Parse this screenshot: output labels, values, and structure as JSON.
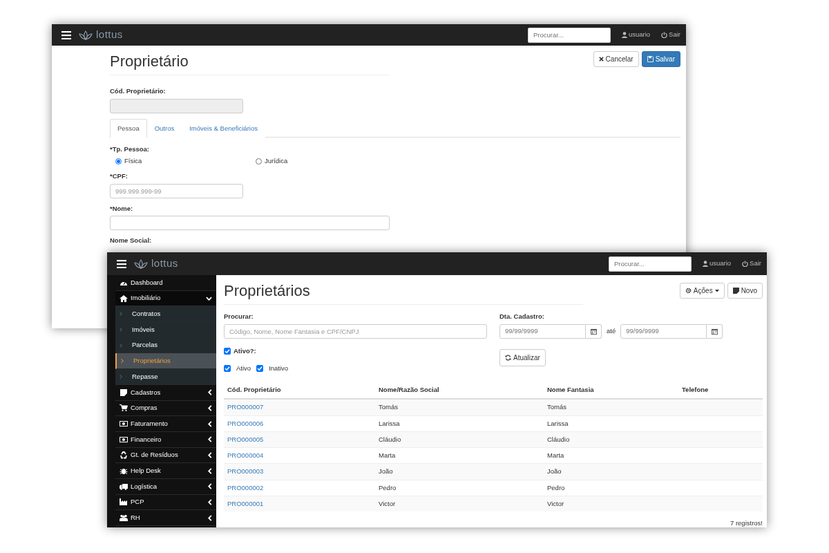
{
  "form_window": {
    "navbar": {
      "brand": "lottus",
      "search_placeholder": "Procurar...",
      "user": "usuario",
      "logout": "Sair"
    },
    "title": "Proprietário",
    "buttons": [
      {
        "kind": "cancel",
        "label": "Cancelar"
      },
      {
        "kind": "save",
        "label": "Salvar"
      }
    ],
    "code_field": {
      "label": "Cód. Proprietário:",
      "disabled": true
    },
    "tabs": [
      {
        "label": "Pessoa",
        "selected": true
      },
      {
        "label": "Outros",
        "selected": false
      },
      {
        "label": "Imóveis & Beneficiários",
        "selected": false
      }
    ],
    "person_type": {
      "label": "*Tp. Pessoa:",
      "options": [
        {
          "label": "Física",
          "selected": true
        },
        {
          "label": "Jurídica",
          "selected": false
        }
      ]
    },
    "cpf_field": {
      "label": "*CPF:",
      "placeholder": "999.999.999-99"
    },
    "name_field": {
      "label": "*Nome:"
    },
    "social_name_label": "Nome Social:"
  },
  "list_window": {
    "navbar": {
      "brand": "lottus",
      "search_placeholder": "Procurar...",
      "user": "usuario",
      "logout": "Sair"
    },
    "sidebar": {
      "items": [
        {
          "kind": "link",
          "label": "Dashboard"
        },
        {
          "kind": "group",
          "label": "Imobiliário",
          "expanded": true,
          "children": [
            {
              "label": "Contratos",
              "selected": false
            },
            {
              "label": "Imóveis",
              "selected": false
            },
            {
              "label": "Parcelas",
              "selected": false
            },
            {
              "label": "Proprietários",
              "selected": true
            },
            {
              "label": "Repasse",
              "selected": false
            }
          ]
        },
        {
          "kind": "group",
          "label": "Cadastros",
          "expanded": false
        },
        {
          "kind": "group",
          "label": "Compras",
          "expanded": false
        },
        {
          "kind": "group",
          "label": "Faturamento",
          "expanded": false
        },
        {
          "kind": "group",
          "label": "Financeiro",
          "expanded": false
        },
        {
          "kind": "group",
          "label": "Gt. de Resíduos",
          "expanded": false
        },
        {
          "kind": "group",
          "label": "Help Desk",
          "expanded": false
        },
        {
          "kind": "group",
          "label": "Logística",
          "expanded": false
        },
        {
          "kind": "group",
          "label": "PCP",
          "expanded": false
        },
        {
          "kind": "group",
          "label": "RH",
          "expanded": false
        }
      ]
    },
    "title": "Proprietários",
    "buttons": [
      {
        "kind": "actions",
        "label": "Ações"
      },
      {
        "kind": "new",
        "label": "Novo"
      }
    ],
    "filters": {
      "search": {
        "label": "Procurar:",
        "placeholder": "Código, Nome, Nome Fantasia e CPF/CNPJ"
      },
      "date": {
        "label": "Dta. Cadastro:",
        "from_placeholder": "99/99/9999",
        "separator": "até",
        "to_placeholder": "99/99/9999"
      },
      "active": {
        "label": "Ativo?:",
        "checked": true,
        "options": [
          {
            "label": "Ativo",
            "checked": true
          },
          {
            "label": "Inativo",
            "checked": true
          }
        ]
      },
      "refresh_button": "Atualizar"
    },
    "table": {
      "columns": [
        "Cód. Proprietário",
        "Nome/Razão Social",
        "Nome Fantasia",
        "Telefone"
      ],
      "rows": [
        [
          "PRO000007",
          "Tomás",
          "Tomás",
          ""
        ],
        [
          "PRO000006",
          "Larissa",
          "Larissa",
          ""
        ],
        [
          "PRO000005",
          "Cláudio",
          "Cláudio",
          ""
        ],
        [
          "PRO000004",
          "Marta",
          "Marta",
          ""
        ],
        [
          "PRO000003",
          "João",
          "João",
          ""
        ],
        [
          "PRO000002",
          "Pedro",
          "Pedro",
          ""
        ],
        [
          "PRO000001",
          "Victor",
          "Victor",
          ""
        ]
      ]
    },
    "record_count": "7 registros!"
  }
}
